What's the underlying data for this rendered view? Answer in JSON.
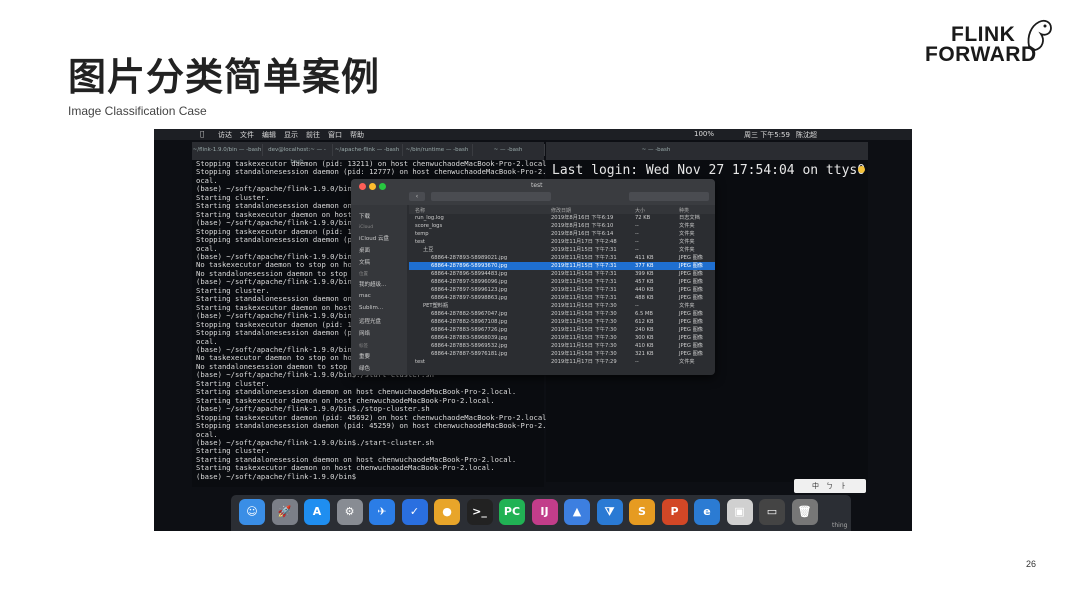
{
  "slide": {
    "title": "图片分类简单案例",
    "subtitle": "Image Classification Case",
    "page_number": "26",
    "logo": {
      "line1": "FLINK",
      "line2": "FORWARD"
    }
  },
  "menubar": {
    "apple": "",
    "items": [
      "访达",
      "文件",
      "编辑",
      "显示",
      "前往",
      "窗口",
      "帮助"
    ],
    "right_status": "100%",
    "clock": "周三 下午5:59",
    "user": "陈沈超"
  },
  "terminal_left": {
    "tabs": [
      "~/flink-1.9.0/bin — -bash",
      "dev@localhost:~ — -bash",
      "~/apache-flink — -bash",
      "~/bin/runtime — -bash",
      "~ — -bash"
    ],
    "lines": [
      "Stopping taskexecutor daemon (pid: 13211) on host chenwuchaodeMacBook-Pro-2.local.",
      "Stopping standalonesession daemon (pid: 12777) on host chenwuchaodeMacBook-Pro-2.l",
      "ocal.",
      "(base) ~/soft/apache/flink-1.9.0/bin$",
      "Starting cluster.",
      "Starting standalonesession daemon on",
      "Starting taskexecutor daemon on host",
      "(base) ~/soft/apache/flink-1.9.0/bin$",
      "Stopping taskexecutor daemon (pid: 1",
      "Stopping standalonesession daemon (p",
      "ocal.",
      "(base) ~/soft/apache/flink-1.9.0/bin$",
      "No taskexecutor daemon to stop on ho",
      "No standalonesession daemon to stop",
      "(base) ~/soft/apache/flink-1.9.0/bin$",
      "Starting cluster.",
      "Starting standalonesession daemon on",
      "Starting taskexecutor daemon on host",
      "(base) ~/soft/apache/flink-1.9.0/bin$",
      "Stopping taskexecutor daemon (pid: 1",
      "Stopping standalonesession daemon (p",
      "ocal.",
      "(base) ~/soft/apache/flink-1.9.0/bin$",
      "No taskexecutor daemon to stop on ho",
      "No standalonesession daemon to stop",
      "(base) ~/soft/apache/flink-1.9.0/bin$./start-cluster.sh",
      "Starting cluster.",
      "Starting standalonesession daemon on host chenwuchaodeMacBook-Pro-2.local.",
      "Starting taskexecutor daemon on host chenwuchaodeMacBook-Pro-2.local.",
      "(base) ~/soft/apache/flink-1.9.0/bin$./stop-cluster.sh",
      "Stopping taskexecutor daemon (pid: 45692) on host chenwuchaodeMacBook-Pro-2.local.",
      "Stopping standalonesession daemon (pid: 45259) on host chenwuchaodeMacBook-Pro-2.l",
      "ocal.",
      "(base) ~/soft/apache/flink-1.9.0/bin$./start-cluster.sh",
      "Starting cluster.",
      "Starting standalonesession daemon on host chenwuchaodeMacBook-Pro-2.local.",
      "Starting taskexecutor daemon on host chenwuchaodeMacBook-Pro-2.local.",
      "(base) ~/soft/apache/flink-1.9.0/bin$"
    ]
  },
  "terminal_right": {
    "tab_title": "~ — -bash",
    "text": "Last login: Wed Nov 27 17:54:04 on ttys0"
  },
  "finder": {
    "path_title": "test",
    "sidebar": [
      "下载",
      "iCloud",
      "iCloud 云盘",
      "桌面",
      "文稿",
      "位置",
      "我的超级...",
      "mac",
      "Sublim...",
      "远程光盘",
      "网络",
      "标签",
      "重要",
      "绿色"
    ],
    "columns": [
      "名称",
      "修改日期",
      "大小",
      "种类"
    ],
    "rows": [
      {
        "name": "run_log.log",
        "date": "2019年8月16日 下午6:19",
        "size": "72 KB",
        "kind": "日志文档"
      },
      {
        "name": "score_logs",
        "date": "2019年8月16日 下午6:10",
        "size": "--",
        "kind": "文件夹"
      },
      {
        "name": "temp",
        "date": "2019年8月16日 下午6:14",
        "size": "--",
        "kind": "文件夹"
      },
      {
        "name": "test",
        "date": "2019年11月17日 下午2:48",
        "size": "--",
        "kind": "文件夹"
      },
      {
        "name": "土豆",
        "date": "2019年11月15日 下午7:31",
        "size": "--",
        "kind": "文件夹"
      },
      {
        "name": "68864-287893-58989021.jpg",
        "date": "2019年11月15日 下午7:31",
        "size": "411 KB",
        "kind": "JPEG 图像"
      },
      {
        "name": "68864-287896-58993670.jpg",
        "date": "2019年11月15日 下午7:31",
        "size": "377 KB",
        "kind": "JPEG 图像"
      },
      {
        "name": "68864-287896-58994483.jpg",
        "date": "2019年11月15日 下午7:31",
        "size": "399 KB",
        "kind": "JPEG 图像"
      },
      {
        "name": "68864-287897-58996096.jpg",
        "date": "2019年11月15日 下午7:31",
        "size": "457 KB",
        "kind": "JPEG 图像"
      },
      {
        "name": "68864-287897-58996123.jpg",
        "date": "2019年11月15日 下午7:31",
        "size": "440 KB",
        "kind": "JPEG 图像"
      },
      {
        "name": "68864-287897-58998863.jpg",
        "date": "2019年11月15日 下午7:31",
        "size": "488 KB",
        "kind": "JPEG 图像"
      },
      {
        "name": "PET塑料瓶",
        "date": "2019年11月15日 下午7:30",
        "size": "--",
        "kind": "文件夹"
      },
      {
        "name": "68864-287882-58967047.jpg",
        "date": "2019年11月15日 下午7:30",
        "size": "6.5 MB",
        "kind": "JPEG 图像"
      },
      {
        "name": "68864-287882-58967108.jpg",
        "date": "2019年11月15日 下午7:30",
        "size": "612 KB",
        "kind": "JPEG 图像"
      },
      {
        "name": "68864-287883-58967726.jpg",
        "date": "2019年11月15日 下午7:30",
        "size": "240 KB",
        "kind": "JPEG 图像"
      },
      {
        "name": "68864-287883-58968039.jpg",
        "date": "2019年11月15日 下午7:30",
        "size": "300 KB",
        "kind": "JPEG 图像"
      },
      {
        "name": "68864-287883-58969532.jpg",
        "date": "2019年11月15日 下午7:30",
        "size": "410 KB",
        "kind": "JPEG 图像"
      },
      {
        "name": "68864-287887-58976181.jpg",
        "date": "2019年11月15日 下午7:30",
        "size": "321 KB",
        "kind": "JPEG 图像"
      },
      {
        "name": "test",
        "date": "2019年11月17日 下午7:29",
        "size": "--",
        "kind": "文件夹"
      }
    ],
    "selected_row": 6
  },
  "ime": {
    "items": [
      "中",
      "ㄅ",
      "ㅏ"
    ]
  },
  "dock": {
    "icons": [
      {
        "name": "finder-icon",
        "glyph": "☺",
        "color": "#3a8ee6"
      },
      {
        "name": "launchpad-icon",
        "glyph": "🚀",
        "color": "#7b7f88"
      },
      {
        "name": "app-store-icon",
        "glyph": "A",
        "color": "#1f8ef0"
      },
      {
        "name": "system-preferences-icon",
        "glyph": "⚙",
        "color": "#888c93"
      },
      {
        "name": "feishu-icon",
        "glyph": "✈",
        "color": "#2b7de6"
      },
      {
        "name": "dingtalk-icon",
        "glyph": "✓",
        "color": "#2a6fe0"
      },
      {
        "name": "chrome-icon",
        "glyph": "●",
        "color": "#e8a52a"
      },
      {
        "name": "terminal-icon",
        "glyph": ">_",
        "color": "#222"
      },
      {
        "name": "pycharm-icon",
        "glyph": "PC",
        "color": "#21b254"
      },
      {
        "name": "intellij-icon",
        "glyph": "IJ",
        "color": "#c23d8a"
      },
      {
        "name": "keynote-icon",
        "glyph": "▲",
        "color": "#3d7fe0"
      },
      {
        "name": "vscode-icon",
        "glyph": "⧩",
        "color": "#2a7ad4"
      },
      {
        "name": "sublime-icon",
        "glyph": "S",
        "color": "#e69b21"
      },
      {
        "name": "powerpoint-icon",
        "glyph": "P",
        "color": "#d24726"
      },
      {
        "name": "edge-icon",
        "glyph": "e",
        "color": "#2b7bd3"
      },
      {
        "name": "preview-icon",
        "glyph": "▣",
        "color": "#d0d0d0"
      },
      {
        "name": "file-icon",
        "glyph": "▭",
        "color": "#444"
      },
      {
        "name": "trash-icon",
        "glyph": "🗑",
        "color": "#777"
      }
    ],
    "trailing_label": "thing"
  },
  "colors": {
    "screen_bg": "#0d0f14",
    "selection": "#1f6fd0",
    "title_text": "#222222"
  }
}
